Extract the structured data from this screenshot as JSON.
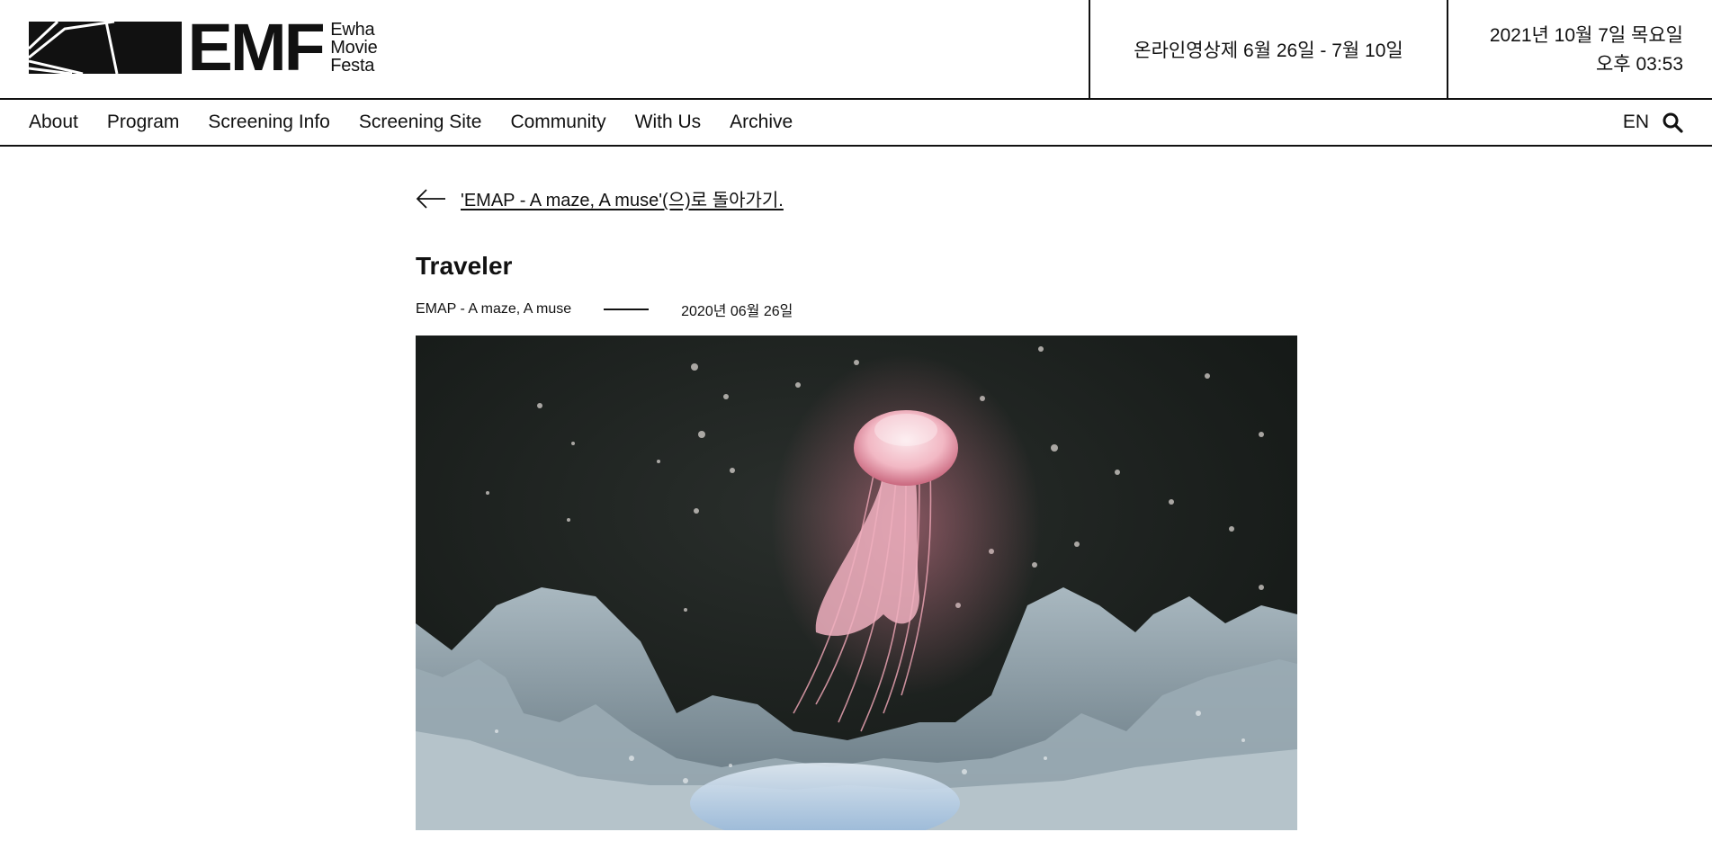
{
  "header": {
    "logo_letters": "EMF",
    "logo_sub": [
      "Ewha",
      "Movie",
      "Festa"
    ],
    "festival_dates": "온라인영상제 6월 26일 - 7월 10일",
    "clock_date": "2021년 10월 7일 목요일",
    "clock_time": "오후 03:53"
  },
  "nav": {
    "items": [
      "About",
      "Program",
      "Screening Info",
      "Screening Site",
      "Community",
      "With Us",
      "Archive"
    ],
    "lang": "EN",
    "search_icon": "search-icon"
  },
  "post": {
    "back_link": "'EMAP - A maze, A muse'(으)로 돌아가기.",
    "title": "Traveler",
    "category": "EMAP - A maze, A muse",
    "date": "2020년 06월 26일",
    "image": "jellyfish-over-icy-terrain"
  },
  "colors": {
    "text": "#111111",
    "background": "#ffffff",
    "image_bg": "#1b201e",
    "jellyfish": "#f2b8c4",
    "terrain": "#8fa2ab"
  }
}
